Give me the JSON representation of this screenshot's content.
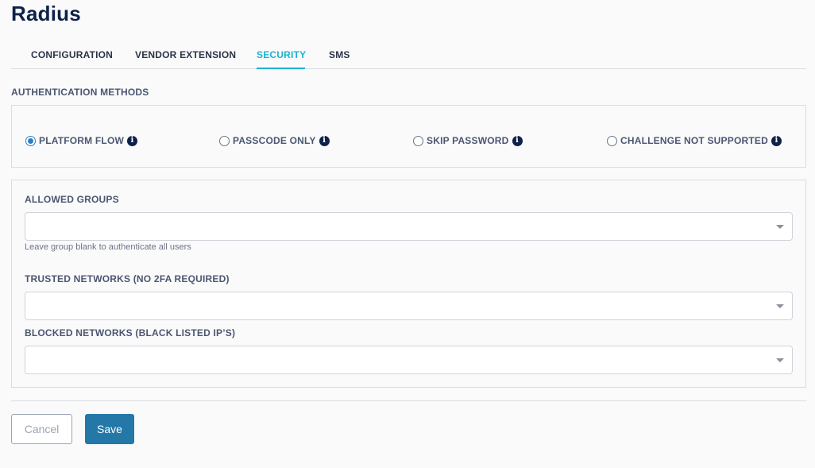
{
  "page": {
    "title": "Radius"
  },
  "tabs": [
    {
      "label": "CONFIGURATION",
      "active": false
    },
    {
      "label": "VENDOR EXTENSION",
      "active": false
    },
    {
      "label": "SECURITY",
      "active": true
    },
    {
      "label": "SMS",
      "active": false
    }
  ],
  "auth_methods": {
    "heading": "AUTHENTICATION METHODS",
    "options": [
      {
        "label": "PLATFORM FLOW",
        "selected": true
      },
      {
        "label": "PASSCODE ONLY",
        "selected": false
      },
      {
        "label": "SKIP PASSWORD",
        "selected": false
      },
      {
        "label": "CHALLENGE NOT SUPPORTED",
        "selected": false
      }
    ],
    "info_glyph": "i"
  },
  "fields": {
    "allowed_groups": {
      "label": "ALLOWED GROUPS",
      "value": "",
      "hint": "Leave group blank to authenticate all users"
    },
    "trusted_networks": {
      "label": "TRUSTED NETWORKS (NO 2FA REQUIRED)",
      "value": ""
    },
    "blocked_networks": {
      "label": "BLOCKED NETWORKS (BLACK LISTED IP’S)",
      "value": ""
    }
  },
  "actions": {
    "cancel_label": "Cancel",
    "save_label": "Save"
  },
  "colors": {
    "accent": "#1bb3d1",
    "primary_button": "#2478a8",
    "title": "#0f2149",
    "radio_selected": "#2d7fc1"
  },
  "icons": {
    "info": "info-circle-icon",
    "dropdown": "caret-down-icon"
  }
}
